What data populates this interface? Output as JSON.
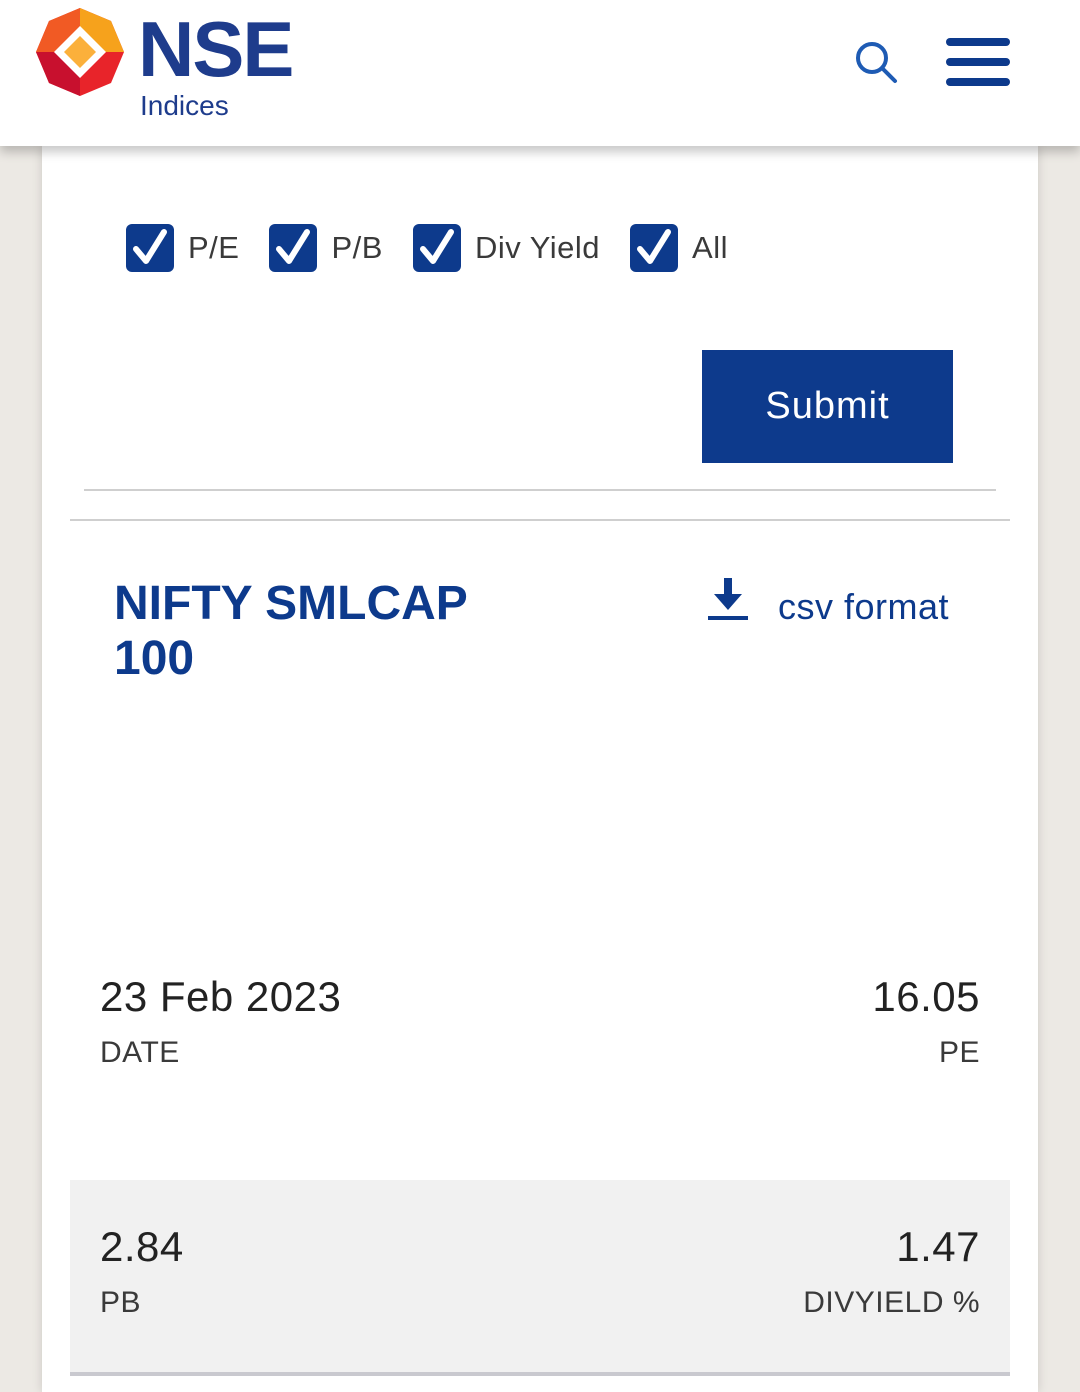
{
  "header": {
    "brand": "NSE",
    "brand_sub": "Indices",
    "colors": {
      "brand_blue": "#1e3c8c",
      "accent_blue": "#0d3a8c"
    }
  },
  "filters": {
    "options": [
      {
        "label": "P/E",
        "checked": true
      },
      {
        "label": "P/B",
        "checked": true
      },
      {
        "label": "Div Yield",
        "checked": true
      },
      {
        "label": "All",
        "checked": true
      }
    ],
    "submit_label": "Submit"
  },
  "result": {
    "index_name": "NIFTY SMLCAP 100",
    "csv_label": "csv format",
    "date_value": "23 Feb 2023",
    "date_label": "DATE",
    "pe_value": "16.05",
    "pe_label": "PE",
    "pb_value": "2.84",
    "pb_label": "PB",
    "divyield_value": "1.47",
    "divyield_label": "DIVYIELD %"
  }
}
